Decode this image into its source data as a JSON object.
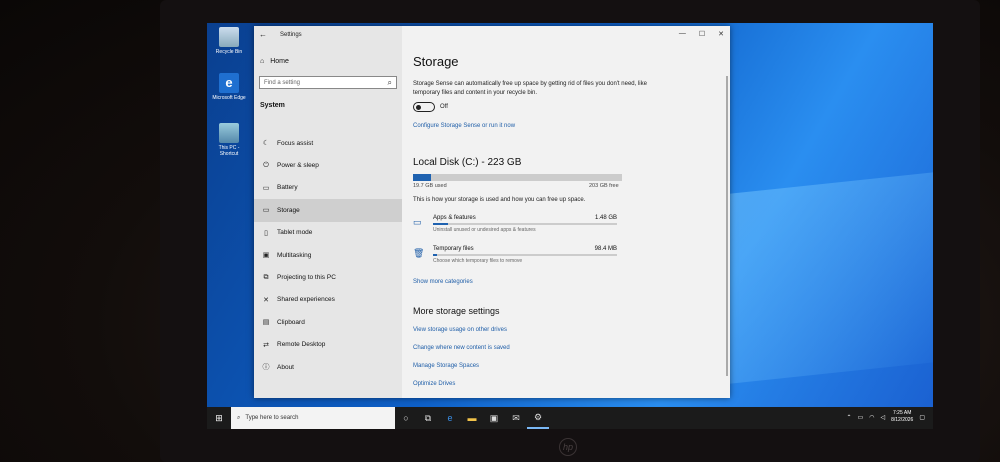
{
  "desktop": {
    "icons": [
      {
        "label": "Recycle Bin",
        "icon": "recycle-bin-icon"
      },
      {
        "label": "Microsoft Edge",
        "icon": "edge-icon"
      },
      {
        "label": "This PC - Shortcut",
        "icon": "pc-icon"
      }
    ]
  },
  "window": {
    "title": "Settings",
    "controls": [
      "—",
      "☐",
      "✕"
    ]
  },
  "nav": {
    "home": "Home",
    "search_placeholder": "Find a setting",
    "section": "System",
    "items": [
      {
        "label": "Focus assist",
        "icon": "moon-icon"
      },
      {
        "label": "Power & sleep",
        "icon": "power-icon"
      },
      {
        "label": "Battery",
        "icon": "battery-icon"
      },
      {
        "label": "Storage",
        "icon": "storage-icon",
        "active": true
      },
      {
        "label": "Tablet mode",
        "icon": "tablet-icon"
      },
      {
        "label": "Multitasking",
        "icon": "multitasking-icon"
      },
      {
        "label": "Projecting to this PC",
        "icon": "projector-icon"
      },
      {
        "label": "Shared experiences",
        "icon": "shared-icon"
      },
      {
        "label": "Clipboard",
        "icon": "clipboard-icon"
      },
      {
        "label": "Remote Desktop",
        "icon": "remote-desktop-icon"
      },
      {
        "label": "About",
        "icon": "info-icon"
      }
    ]
  },
  "storage": {
    "title": "Storage",
    "description": "Storage Sense can automatically free up space by getting rid of files you don't need, like temporary files and content in your recycle bin.",
    "toggle_label": "Off",
    "toggle_on": false,
    "configure_link": "Configure Storage Sense or run it now",
    "disk_title": "Local Disk (C:) - 223 GB",
    "used": "19.7 GB used",
    "free": "203 GB free",
    "used_fraction": 0.088,
    "info": "This is how your storage is used and how you can free up space.",
    "categories": [
      {
        "name": "Apps & features",
        "size": "1.48 GB",
        "sub": "Uninstall unused or undesired apps & features",
        "fraction": 0.08,
        "icon": "apps-icon"
      },
      {
        "name": "Temporary files",
        "size": "98.4 MB",
        "sub": "Choose which temporary files to remove",
        "fraction": 0.02,
        "icon": "trash-icon"
      }
    ],
    "show_more": "Show more categories",
    "more_title": "More storage settings",
    "more_links": [
      "View storage usage on other drives",
      "Change where new content is saved",
      "Manage Storage Spaces",
      "Optimize Drives"
    ]
  },
  "taskbar": {
    "search_placeholder": "Type here to search",
    "time": "7:25 AM",
    "date": "8/12/2026"
  },
  "brand": "hp"
}
